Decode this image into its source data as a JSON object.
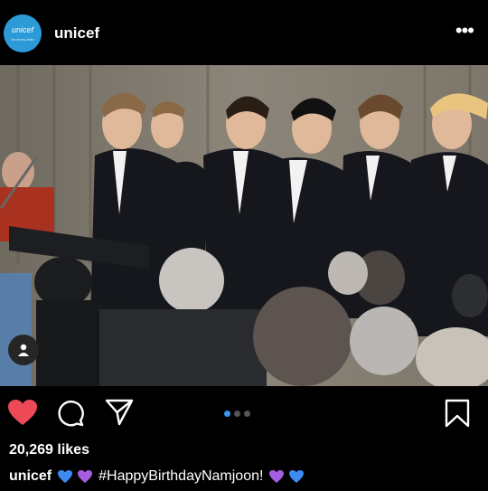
{
  "post": {
    "username": "unicef",
    "avatar": {
      "brand": "unicef",
      "tagline": "for every child",
      "color": "#2c9ad7"
    },
    "menu_icon": "more-dots-icon"
  },
  "actions": {
    "like_icon": "heart-filled-icon",
    "comment_icon": "comment-icon",
    "share_icon": "send-icon",
    "save_icon": "bookmark-icon",
    "like_color": "#ed4956",
    "carousel": {
      "total": 3,
      "active": 1,
      "active_color": "#3897f0"
    }
  },
  "likes_text": "20,269 likes",
  "caption": {
    "username": "unicef",
    "emoji_before": [
      "blue-heart",
      "purple-heart"
    ],
    "text": "#HappyBirthdayNamjoon!",
    "emoji_after": [
      "purple-heart",
      "blue-heart"
    ],
    "heart_colors": {
      "blue-heart": "#3d8bf2",
      "purple-heart": "#a55ee0"
    }
  },
  "photo": {
    "description_icon": "user-tag-icon"
  }
}
